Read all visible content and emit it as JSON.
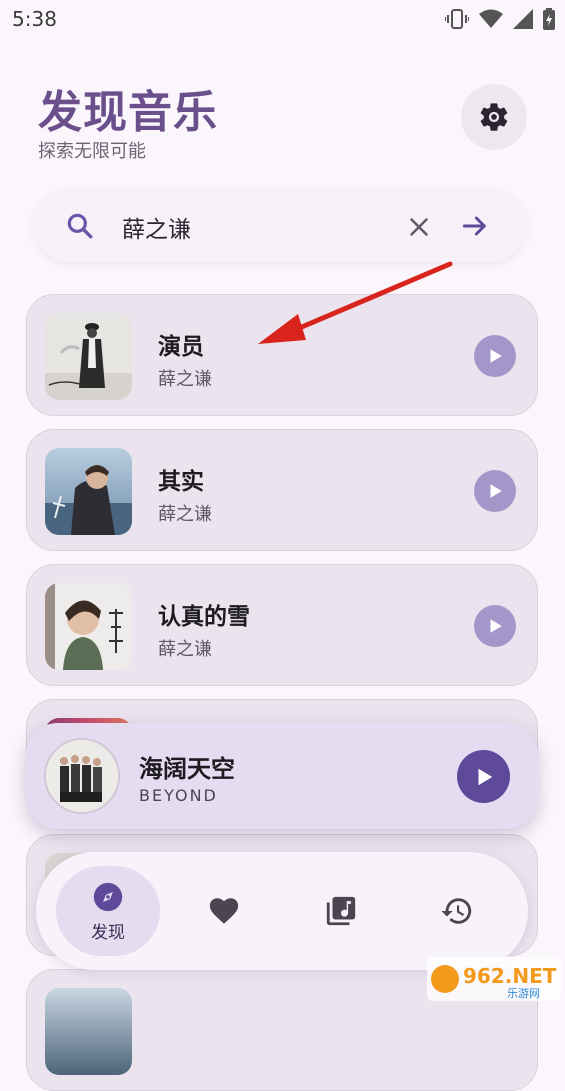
{
  "status": {
    "time": "5:38"
  },
  "header": {
    "title": "发现音乐",
    "subtitle": "探索无限可能"
  },
  "search": {
    "value": "薛之谦"
  },
  "songs": [
    {
      "title": "演员",
      "artist": "薛之谦"
    },
    {
      "title": "其实",
      "artist": "薛之谦"
    },
    {
      "title": "认真的雪",
      "artist": "薛之谦"
    }
  ],
  "now_playing": {
    "title": "海阔天空",
    "artist": "BEYOND"
  },
  "nav": {
    "discover_label": "发现"
  },
  "watermark": {
    "text": "962.NET",
    "sub": "乐游网"
  },
  "colors": {
    "accent": "#6b4f8c",
    "play": "#5e4a99",
    "card": "#ebe4ee"
  }
}
